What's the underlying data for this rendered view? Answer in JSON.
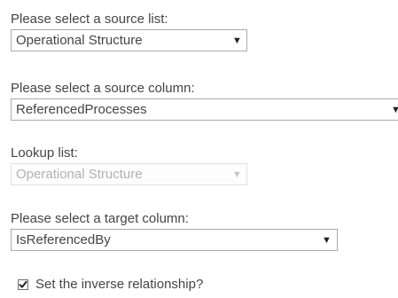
{
  "source_list": {
    "label": "Please select a source list:",
    "selected": "Operational Structure"
  },
  "source_column": {
    "label": "Please select a source column:",
    "selected": "ReferencedProcesses"
  },
  "lookup_list": {
    "label": "Lookup list:",
    "selected": "Operational Structure",
    "disabled": true
  },
  "target_column": {
    "label": "Please select a target column:",
    "selected": "IsReferencedBy"
  },
  "inverse_relationship": {
    "label": "Set the inverse relationship?",
    "checked": true
  },
  "icons": {
    "dropdown": "dropdown-arrow-icon",
    "check": "checkmark-icon"
  },
  "colors": {
    "text": "#444444",
    "disabled_text": "#b1b1b1",
    "border": "#ababab",
    "disabled_border": "#e1e1e1"
  }
}
